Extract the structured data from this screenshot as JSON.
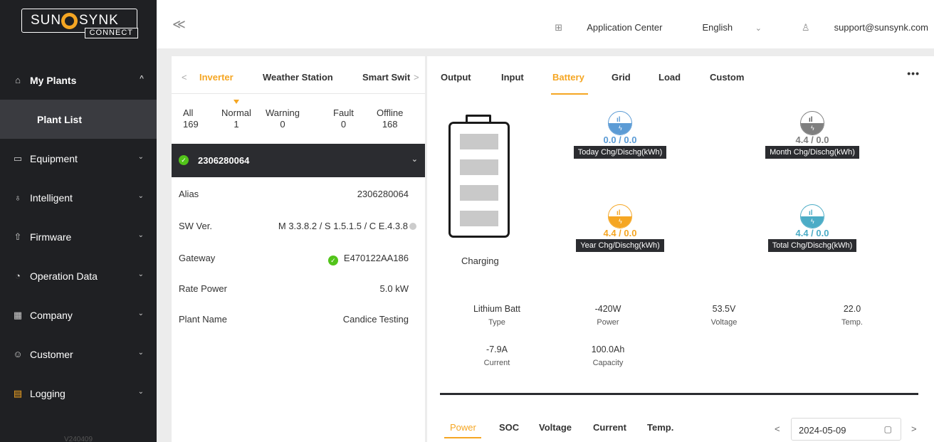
{
  "brand": {
    "left": "SUN",
    "right": "SYNK",
    "sub": "CONNECT"
  },
  "sidebar": {
    "items": [
      {
        "label": "My Plants",
        "icon": "home-icon",
        "glyph": "⌂",
        "chevron": "^"
      },
      {
        "label": "Plant List"
      },
      {
        "label": "Equipment",
        "icon": "equipment-icon",
        "glyph": "▭",
        "chevron": "⌄"
      },
      {
        "label": "Intelligent",
        "icon": "bulb-icon",
        "glyph": "♁",
        "chevron": "⌄"
      },
      {
        "label": "Firmware",
        "icon": "firmware-icon",
        "glyph": "⇧",
        "chevron": "⌄"
      },
      {
        "label": "Operation Data",
        "icon": "stopwatch-icon",
        "glyph": "◔",
        "chevron": "⌄"
      },
      {
        "label": "Company",
        "icon": "building-icon",
        "glyph": "▦",
        "chevron": "⌄"
      },
      {
        "label": "Customer",
        "icon": "users-icon",
        "glyph": "☺",
        "chevron": "⌄"
      },
      {
        "label": "Logging",
        "icon": "logbook-icon",
        "glyph": "▤",
        "chevron": "⌄"
      }
    ],
    "version": "V240409"
  },
  "topbar": {
    "collapse": "≪",
    "app_center": "Application Center",
    "language": "English",
    "lang_chevron": "⌄",
    "user": "support@sunsynk.com"
  },
  "left": {
    "tab_prev": "<",
    "tab_next": ">",
    "tabs": [
      "Inverter",
      "Weather Station",
      "Smart Swit"
    ],
    "stats": [
      {
        "label": "All",
        "value": "169"
      },
      {
        "label": "Normal",
        "value": "1"
      },
      {
        "label": "Warning",
        "value": "0"
      },
      {
        "label": "Fault",
        "value": "0"
      },
      {
        "label": "Offline",
        "value": "168"
      }
    ],
    "device": {
      "id": "2306280064",
      "check": "✓",
      "chevron": "⌄"
    },
    "info": [
      {
        "key": "Alias",
        "value": "2306280064"
      },
      {
        "key": "SW Ver.",
        "value": "M 3.3.8.2 / S  1.5.1.5 / C E.4.3.8"
      },
      {
        "key": "Gateway",
        "value": "E470122AA186"
      },
      {
        "key": "Rate Power",
        "value": "5.0 kW"
      },
      {
        "key": "Plant Name",
        "value": "Candice Testing"
      }
    ]
  },
  "right": {
    "tabs": [
      "Output",
      "Input",
      "Battery",
      "Grid",
      "Load",
      "Custom"
    ],
    "more": "•••",
    "status": "Charging",
    "energy": [
      {
        "value": "0.0 / 0.0",
        "label": "Today Chg/Dischg(kWh)",
        "color": "#5b9bd5",
        "top": "#cfe3f5"
      },
      {
        "value": "4.4 / 0.0",
        "label": "Month Chg/Dischg(kWh)",
        "color": "#7f7f7f",
        "top": "#e6e6e6"
      },
      {
        "value": "4.4 / 0.0",
        "label": "Year Chg/Dischg(kWh)",
        "color": "#f5a623",
        "top": "#fde7bf"
      },
      {
        "value": "4.4 / 0.0",
        "label": "Total Chg/Dischg(kWh)",
        "color": "#4bacc6",
        "top": "#d3edf3"
      }
    ],
    "metrics": [
      {
        "value": "Lithium Batt",
        "label": "Type"
      },
      {
        "value": "-420W",
        "label": "Power"
      },
      {
        "value": "53.5V",
        "label": "Voltage"
      },
      {
        "value": "22.0",
        "label": "Temp."
      },
      {
        "value": "-7.9A",
        "label": "Current"
      },
      {
        "value": "100.0Ah",
        "label": "Capacity"
      }
    ],
    "bottom_tabs": [
      "Power",
      "SOC",
      "Voltage",
      "Current",
      "Temp."
    ],
    "date": "2024-05-09",
    "date_prev": "<",
    "date_next": ">"
  },
  "icons": {
    "apps": "apps-grid-icon",
    "user": "user-icon",
    "calendar": "calendar-icon",
    "check": "check-circle-icon",
    "bars": "signal-bars-icon",
    "bolt": "bolt-icon"
  },
  "colors": {
    "accent": "#f5a623",
    "sidebar": "#1f2023",
    "success": "#52c41a"
  }
}
